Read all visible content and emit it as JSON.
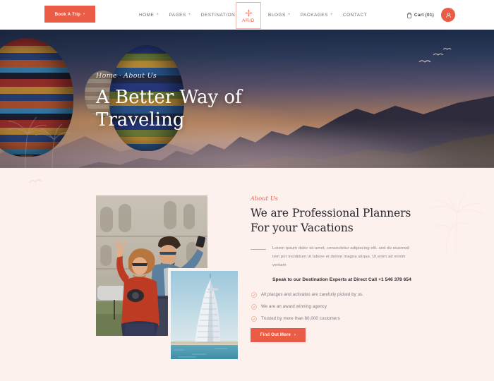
{
  "header": {
    "book_trip_label": "Book A Trip",
    "book_trip_arrow": "›",
    "nav_left": [
      {
        "label": "HOME",
        "caret": "+"
      },
      {
        "label": "PAGES",
        "caret": "+"
      },
      {
        "label": "DESTINATION",
        "caret": "+"
      }
    ],
    "nav_right": [
      {
        "label": "BLOGS",
        "caret": "+"
      },
      {
        "label": "PACKAGES",
        "caret": "+"
      },
      {
        "label": "CONTACT",
        "caret": ""
      }
    ],
    "logo_text": "ARID",
    "cart_label": "Cart (01)"
  },
  "hero": {
    "breadcrumb_home": "Home",
    "breadcrumb_sep": "·",
    "breadcrumb_current": "About Us",
    "title": "A Better Way of Traveling"
  },
  "about": {
    "eyebrow": "About Us",
    "title": "We are Professional Planners For your Vacations",
    "paragraph": "Lorem ipsum dolor sit amet, consectetur adipiscing elit. sed do eiusmod tem por incididunt ut labore et dolore magna aliqua. Ut enim ad minim veniam",
    "contact_line": "Speak to our Destination Experts at Direct Call +1 546 378 654",
    "features": [
      "All placges and activates are carefully picked by us.",
      "We are an award winning agency",
      "Trusted by more than 80,000 customers"
    ],
    "cta_label": "Find Out More",
    "cta_arrow": "›"
  },
  "colors": {
    "accent": "#ea5c45",
    "section_bg": "#fdf1ee",
    "heading": "#25252b",
    "body_text": "#8b8088"
  }
}
